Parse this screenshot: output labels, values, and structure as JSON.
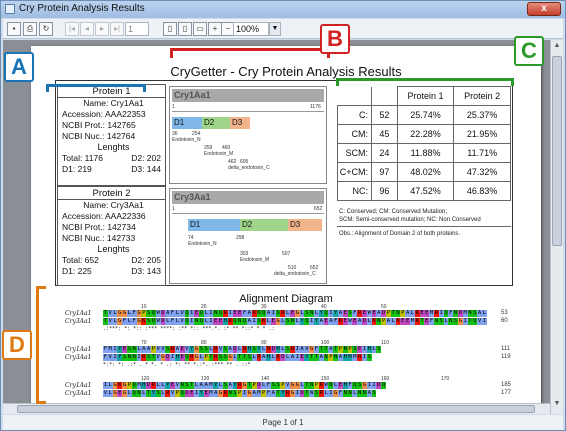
{
  "window": {
    "title": "Cry Protein Analysis Results",
    "close_label": "x"
  },
  "toolbar": {
    "page_input": "1",
    "zoom_value": "100%",
    "icons": [
      "save-icon",
      "print-icon",
      "refresh-icon",
      "first-page-icon",
      "prev-page-icon",
      "next-page-icon",
      "last-page-icon",
      "single-page-icon",
      "double-page-icon",
      "fit-page-icon",
      "zoom-in-icon",
      "zoom-out-icon"
    ]
  },
  "report": {
    "title": "CryGetter - Cry Protein Analysis Results",
    "protein1": {
      "header": "Protein 1",
      "name": "Name: Cry1Aa1",
      "accession": "Accession: AAA22353",
      "ncbi_prot": "NCBI Prot.: 142765",
      "ncbi_nuc": "NCBI Nuc.: 142764",
      "lengths_label": "Lenghts",
      "total": "Total: 1176",
      "d2": "D2: 202",
      "d1": "D1: 219",
      "d3": "D3: 144"
    },
    "protein2": {
      "header": "Protein 2",
      "name": "Name: Cry3Aa1",
      "accession": "Accession: AAA22336",
      "ncbi_prot": "NCBI Prot.: 142734",
      "ncbi_nuc": "NCBI Nuc.: 142733",
      "lengths_label": "Lenghts",
      "total": "Total: 652",
      "d2": "D2: 205",
      "d1": "D1: 225",
      "d3": "D3: 143"
    },
    "diagram1": {
      "name": "Cry1Aa1",
      "start": "1",
      "end": "1176",
      "d1": "D1",
      "d2": "D2",
      "d3": "D3",
      "labels": [
        "36",
        "254",
        "Endotoxin_N",
        "259",
        "460",
        "Endotoxin_M",
        "462",
        "605",
        "delta_endotoxin_C"
      ]
    },
    "diagram2": {
      "name": "Cry3Aa1",
      "start": "1",
      "end": "652",
      "d1": "D1",
      "d2": "D2",
      "d3": "D3",
      "labels": [
        "74",
        "298",
        "Endotoxin_N",
        "303",
        "507",
        "Endotoxin_M",
        "510",
        "652",
        "delta_endotoxin_C"
      ]
    },
    "stats": {
      "header": [
        "",
        "Protein 1",
        "Protein 2"
      ],
      "rows": [
        {
          "label": "C:",
          "count": "52",
          "p1": "25.74%",
          "p2": "25.37%"
        },
        {
          "label": "CM:",
          "count": "45",
          "p1": "22.28%",
          "p2": "21.95%"
        },
        {
          "label": "SCM:",
          "count": "24",
          "p1": "11.88%",
          "p2": "11.71%"
        },
        {
          "label": "C+CM:",
          "count": "97",
          "p1": "48.02%",
          "p2": "47.32%"
        },
        {
          "label": "NC:",
          "count": "96",
          "p1": "47.52%",
          "p2": "46.83%"
        }
      ],
      "legend1": "C: Conserved; CM: Conserved Mutation;",
      "legend2": "SCM: Semi-conserved mutation; NC: Non Conserved",
      "obs": "Obs.: Alignment of Domain 2 of both proteins."
    },
    "alignment": {
      "title": "Alignment Diagram",
      "blocks": [
        {
          "rows": [
            {
              "name": "Cry1Aa1",
              "seq": "TVLGGLFGPSQWDAFLVQIEQLINQRIEEFARNQAISRLEGLSNLYQIYAESFREWEADPTNPALREEMRIQFNDMNSALTTAIPLFAV",
              "end": "53"
            },
            {
              "name": "Cry3Aa1",
              "seq": "TVLGFLFGKSQWDLFLVQINQLIEEHRQNQAISKLEGLSNLYQIYAEAFREWEADLKNPALKEEMRTEFNSLNSGITQVIPLFAL",
              "end": "60"
            }
          ],
          "numbers": [
            "10",
            "20",
            "30",
            "40",
            "50"
          ],
          "consensus": " .:***: *: *:: :*** ****: :** *:: ***.*. :*  ** *::* * *  .:"
        },
        {
          "rows": [
            {
              "name": "Cry1Aa1",
              "seq": "FMIYESNLAAPVVSRAEVYGSSLRVSADLRHSYLRDHLSRIAVGFTTATPNPSEIHLS",
              "end": "111"
            },
            {
              "name": "Cry3Aa1",
              "seq": "FVIYSNNIRSTVGDIHEQRGLPTRSSGLTTSLRAHLRDLAIEYTTANPNAHHMRIS",
              "end": "119"
            }
          ],
          "numbers": [
            "70",
            "80",
            "90",
            "100",
            "110"
          ],
          "consensus": " *:*: *: .:* .  *   *.  *  .: *:  ** *.:*. :*** ** .  ::*"
        },
        {
          "rows": [
            {
              "name": "Cry1Aa1",
              "seq": "ILGKGPQMHDRLLYEVNSTLAAMYLSAYRGTPDLFSSPVGGLTNPRWNLEHFQSGIIDQ",
              "end": "185"
            },
            {
              "name": "Cry3Aa1",
              "seq": "VLGEGLQNLTYSLRVPQDEIYEMAGRNSPIGAMPFATYRGIDTWSRLIGFNNLNNAS",
              "end": "177"
            }
          ],
          "numbers": [
            "120",
            "130",
            "140",
            "150",
            "160",
            "170"
          ],
          "consensus": ""
        }
      ]
    }
  },
  "callouts": {
    "a": "A",
    "b": "B",
    "c": "C",
    "d": "D",
    "colors": {
      "a": "#1a75b8",
      "b": "#d32020",
      "c": "#2a9a2a",
      "d": "#e07a10"
    }
  },
  "status_bar": "Page 1 of 1"
}
